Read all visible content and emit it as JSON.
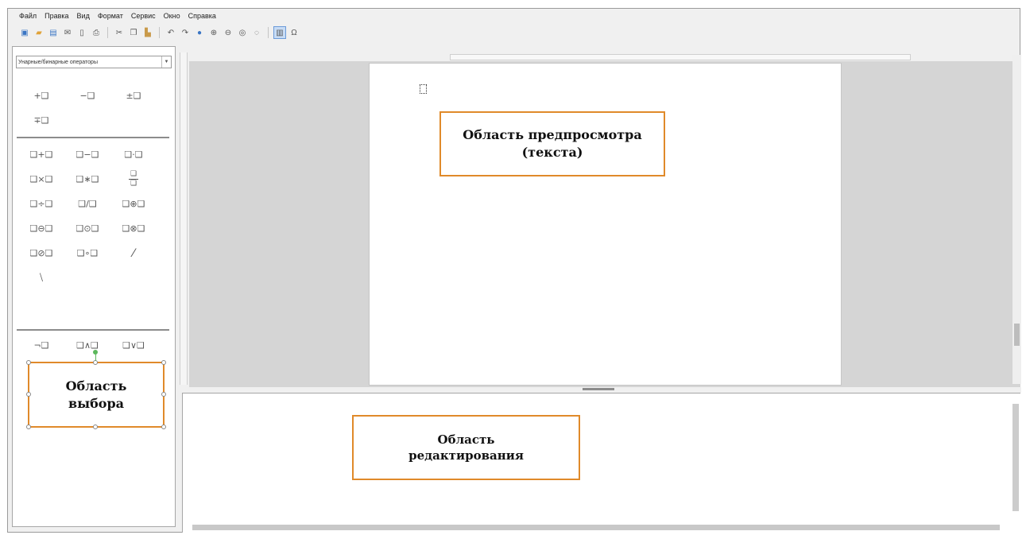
{
  "menu": [
    "Файл",
    "Правка",
    "Вид",
    "Формат",
    "Сервис",
    "Окно",
    "Справка"
  ],
  "sidebar": {
    "category": "Унарные/бинарные операторы",
    "unary_ops": [
      "+❑",
      "−❑",
      "±❑",
      "∓❑"
    ],
    "binary_ops": [
      "❑+❑",
      "❑−❑",
      "❑·❑",
      "❑×❑",
      "❑∗❑",
      "❑/❑ (дробь)",
      "❑÷❑",
      "❑/❑",
      "❑⊕❑",
      "❑⊖❑",
      "❑⊙❑",
      "❑⊗❑",
      "❑⊘❑",
      "❑∘❑",
      "❑╱❑",
      "❑╲❑"
    ],
    "logic_ops": [
      "¬❑",
      "❑∧❑",
      "❑∨❑"
    ]
  },
  "callouts": {
    "preview_line1": "Область предпросмотра",
    "preview_line2": "(текста)",
    "select_line1": "Область",
    "select_line2": "выбора",
    "edit_line1": "Область",
    "edit_line2": "редактирования"
  },
  "colors": {
    "callout_border": "#e08a2a",
    "accent": "#3a75c4"
  }
}
